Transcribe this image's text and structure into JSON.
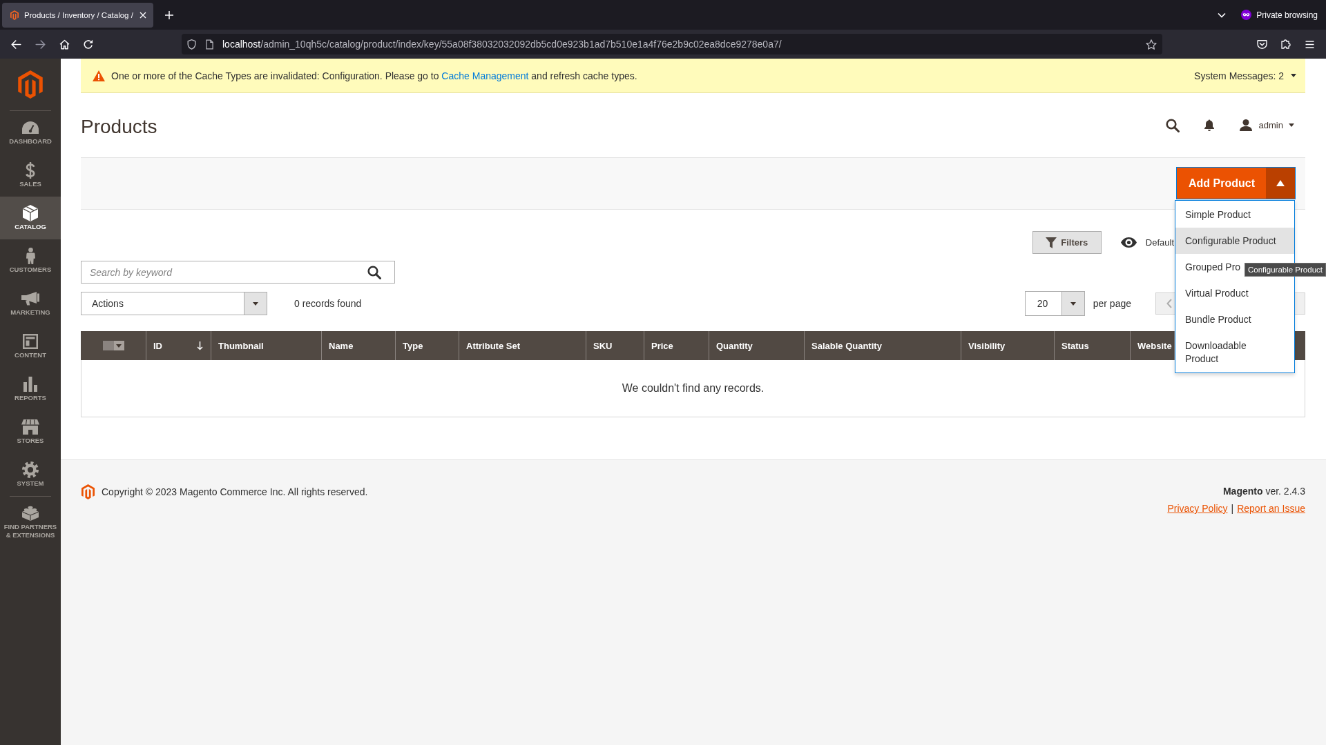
{
  "browser": {
    "tabs": [
      {
        "title": "Products / Inventory / Catalog /",
        "selected": true
      }
    ],
    "private_label": "Private browsing",
    "back_disabled": false,
    "forward_disabled": true,
    "url_host": "localhost",
    "url_path": "/admin_10qh5c/catalog/product/index/key/55a08f38032032092db5cd0e923b1ad7b510e1a4f76e2b9c02ea8dce9278e0a7/"
  },
  "sidebar": {
    "items": [
      {
        "kind": "dashboard",
        "label": "DASHBOARD",
        "selected": false
      },
      {
        "kind": "sales",
        "label": "SALES",
        "selected": false
      },
      {
        "kind": "catalog",
        "label": "CATALOG",
        "selected": true
      },
      {
        "kind": "customers",
        "label": "CUSTOMERS",
        "selected": false
      },
      {
        "kind": "marketing",
        "label": "MARKETING",
        "selected": false
      },
      {
        "kind": "content",
        "label": "CONTENT",
        "selected": false
      },
      {
        "kind": "reports",
        "label": "REPORTS",
        "selected": false
      },
      {
        "kind": "stores",
        "label": "STORES",
        "selected": false
      },
      {
        "kind": "system",
        "label": "SYSTEM",
        "selected": false
      },
      {
        "kind": "partners",
        "label": "FIND PARTNERS & EXTENSIONS",
        "selected": false
      }
    ]
  },
  "message": {
    "parts": [
      {
        "kind": "text",
        "text": "One or more of the Cache Types are invalidated: Configuration. Please go to "
      },
      {
        "kind": "link",
        "text": "Cache Management"
      },
      {
        "kind": "text",
        "text": " and refresh cache types."
      }
    ],
    "system_messages": "System Messages: 2"
  },
  "header": {
    "title": "Products",
    "user": "admin"
  },
  "page_actions": {
    "add_button": "Add Product",
    "expanded": true,
    "menu": [
      {
        "label": "Simple Product",
        "selected": false
      },
      {
        "label": "Configurable Product",
        "selected": true
      },
      {
        "label": "Grouped Pro",
        "selected": false
      },
      {
        "label": "Virtual Product",
        "selected": false
      },
      {
        "label": "Bundle Product",
        "selected": false
      },
      {
        "label": "Downloadable Product",
        "selected": false
      }
    ],
    "tooltip": "Configurable Product"
  },
  "toolbar": {
    "filters": "Filters",
    "view": "Default",
    "search": {
      "placeholder": "Search by keyword"
    },
    "actions": "Actions",
    "records": "0 records found",
    "per_page": "20",
    "per_page_label": "per page"
  },
  "grid": {
    "columns": [
      {
        "label": "ID",
        "sorted": true
      },
      {
        "label": "Thumbnail",
        "sorted": false
      },
      {
        "label": "Name",
        "sorted": false
      },
      {
        "label": "Type",
        "sorted": false
      },
      {
        "label": "Attribute Set",
        "sorted": false
      },
      {
        "label": "SKU",
        "sorted": false
      },
      {
        "label": "Price",
        "sorted": false
      },
      {
        "label": "Quantity",
        "sorted": false
      },
      {
        "label": "Salable Quantity",
        "sorted": false
      },
      {
        "label": "Visibility",
        "sorted": false
      },
      {
        "label": "Status",
        "sorted": false
      },
      {
        "label": "Website",
        "sorted": false
      }
    ],
    "empty_message": "We couldn't find any records."
  },
  "footer": {
    "copyright": "Copyright © 2023 Magento Commerce Inc. All rights reserved.",
    "version": "**Magento** ver. 2.4.3",
    "links": [
      "Privacy Policy",
      "Report an Issue"
    ],
    "link_separator": "|"
  }
}
